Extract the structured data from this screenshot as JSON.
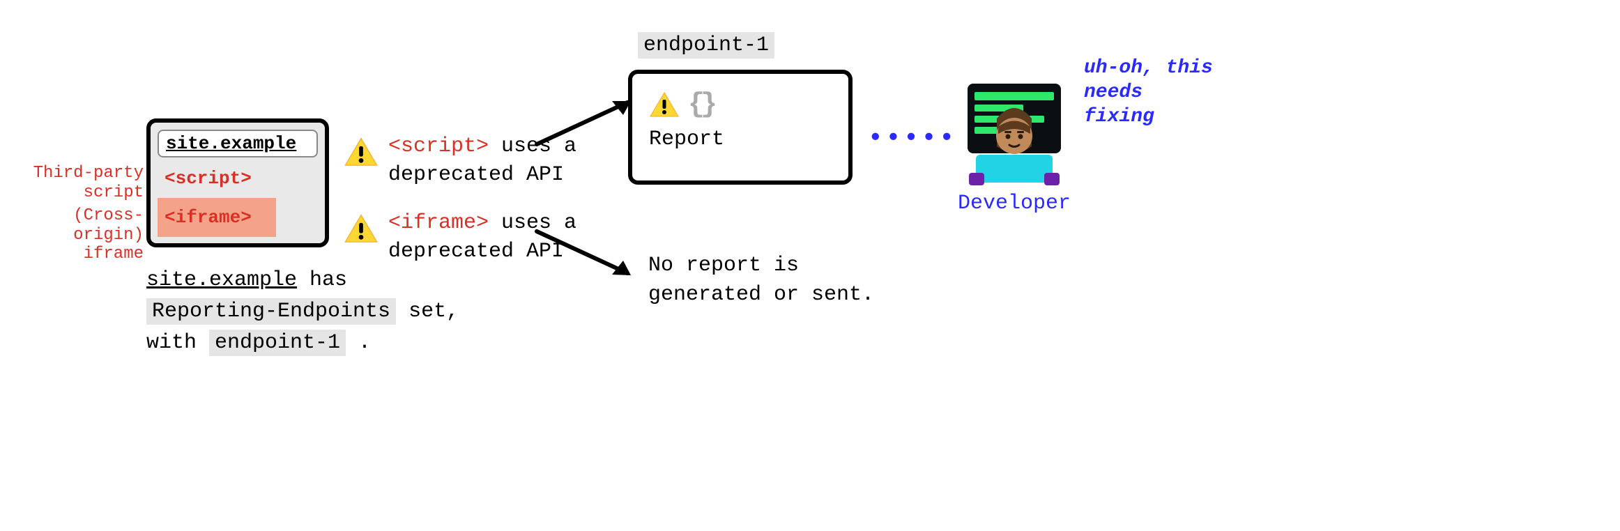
{
  "browser": {
    "url": "site.example",
    "script_tag": "<script>",
    "iframe_tag": "<iframe>"
  },
  "left_annotations": {
    "third_party_line1": "Third-party",
    "third_party_line2": "script",
    "cross_origin_line1": "(Cross-origin)",
    "cross_origin_line2": "iframe"
  },
  "caption": {
    "seg1": "site.example",
    "seg2": " has ",
    "seg3": "Reporting-Endpoints",
    "seg4": " set, with ",
    "seg5": "endpoint-1",
    "seg6": " ."
  },
  "warnings": {
    "script": {
      "code": "<script>",
      "rest": " uses a deprecated API"
    },
    "iframe": {
      "code": "<iframe>",
      "rest": " uses a deprecated API"
    }
  },
  "endpoint": {
    "name": "endpoint-1",
    "report_label": "Report",
    "braces": "{}"
  },
  "no_report": "No report is generated or sent.",
  "developer": {
    "label": "Developer",
    "uhoh": "uh-oh, this needs fixing"
  },
  "dots": "•••••"
}
